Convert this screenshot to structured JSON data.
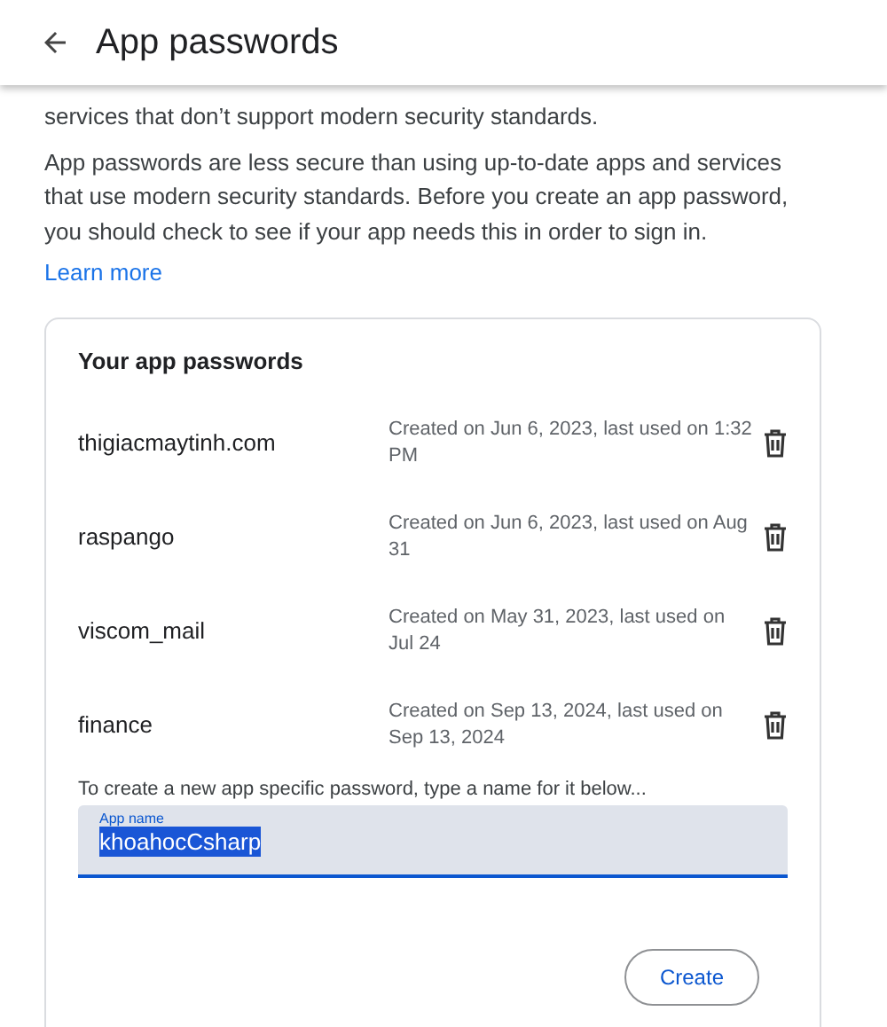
{
  "header": {
    "title": "App passwords"
  },
  "intro": [
    "services that don’t support modern security standards.",
    "App passwords are less secure than using up-to-date apps and services that use modern security standards. Before you create an app password, you should check to see if your app needs this in order to sign in."
  ],
  "learn_more": "Learn more",
  "card": {
    "title": "Your app passwords",
    "passwords": [
      {
        "name": "thigiacmaytinh.com",
        "details": "Created on Jun 6, 2023, last used on 1:32 PM"
      },
      {
        "name": "raspango",
        "details": "Created on Jun 6, 2023, last used on Aug 31"
      },
      {
        "name": "viscom_mail",
        "details": "Created on May 31, 2023, last used on Jul 24"
      },
      {
        "name": "finance",
        "details": "Created on Sep 13, 2024, last used on Sep 13, 2024"
      }
    ],
    "instruction": "To create a new app specific password, type a name for it below...",
    "field": {
      "label": "App name",
      "value": "khoahocCsharp",
      "selected": true
    },
    "create_button": "Create"
  }
}
